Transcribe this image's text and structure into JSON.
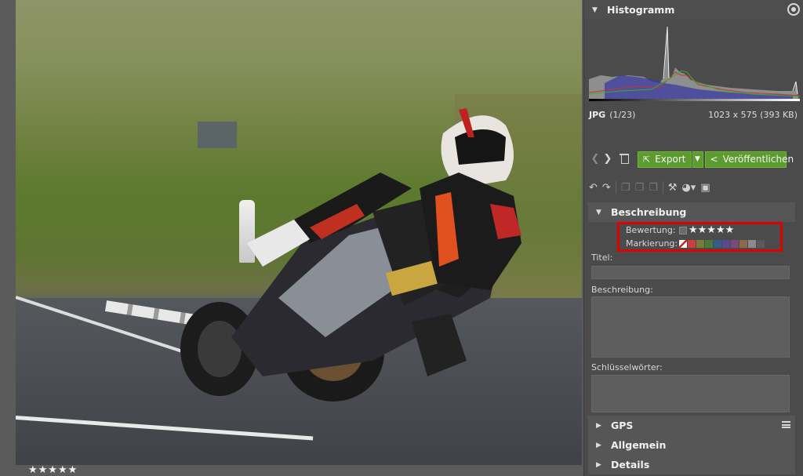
{
  "viewer": {
    "thumbnail_rating": "★★★★★"
  },
  "histogram": {
    "title": "Histogramm",
    "format": "JPG",
    "index": "(1/23)",
    "dimensions": "1023 x 575 (393 KB)"
  },
  "toolbar": {
    "export_label": "Export",
    "publish_label": "Veröffentlichen"
  },
  "description_section": {
    "title": "Beschreibung",
    "rating_label": "Bewertung:",
    "rating_value": "★★★★★",
    "marking_label": "Markierung:",
    "marking_colors": [
      "#c84040",
      "#7a7a3a",
      "#4a7a3a",
      "#3a5a8a",
      "#5a4a8a",
      "#7a4a7a",
      "#8a6a4a",
      "#8a8a8a",
      "#5a5a5a"
    ],
    "title_label": "Titel:",
    "title_value": "",
    "description_label": "Beschreibung:",
    "description_value": "",
    "keywords_label": "Schlüsselwörter:",
    "keywords_value": ""
  },
  "sections": {
    "gps": "GPS",
    "general": "Allgemein",
    "details": "Details"
  },
  "colors": {
    "accent_green": "#5c9b2d",
    "highlight_red": "#e00000"
  }
}
